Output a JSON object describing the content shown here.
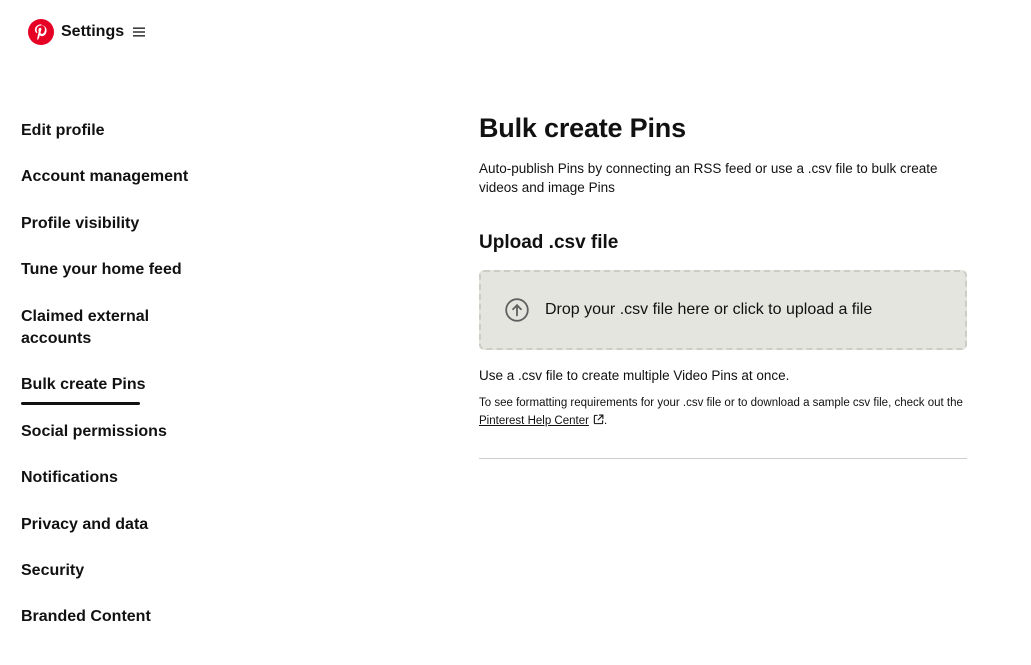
{
  "header": {
    "logo_icon": "pinterest-logo-icon",
    "brand_color": "#e60023",
    "title": "Settings",
    "menu_icon": "hamburger-menu-icon"
  },
  "sidebar": {
    "active_index": 5,
    "items": [
      {
        "label": "Edit profile"
      },
      {
        "label": "Account management"
      },
      {
        "label": "Profile visibility"
      },
      {
        "label": "Tune your home feed"
      },
      {
        "label": "Claimed external accounts"
      },
      {
        "label": "Bulk create Pins"
      },
      {
        "label": "Social permissions"
      },
      {
        "label": "Notifications"
      },
      {
        "label": "Privacy and data"
      },
      {
        "label": "Security"
      },
      {
        "label": "Branded Content"
      }
    ]
  },
  "main": {
    "title": "Bulk create Pins",
    "description": "Auto-publish Pins by connecting an RSS feed or use a .csv file to bulk create videos and image Pins",
    "upload_section_title": "Upload .csv file",
    "dropzone": {
      "icon": "upload-arrow-icon",
      "text": "Drop your .csv file here or click to upload a file",
      "background_color": "#e5e5e0"
    },
    "helper_text": "Use a .csv file to create multiple Video Pins at once.",
    "note_prefix": "To see formatting requirements for your .csv file or to download a sample csv file, check out the ",
    "note_link": "Pinterest Help Center",
    "note_link_icon": "external-link-icon",
    "note_suffix": "."
  }
}
